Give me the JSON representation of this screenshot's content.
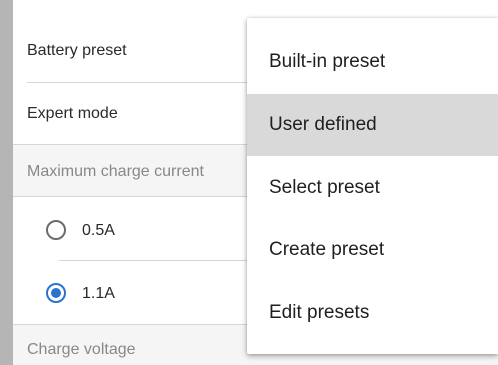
{
  "settings": {
    "battery_preset_label": "Battery preset",
    "expert_mode_label": "Expert mode",
    "max_charge_section": "Maximum charge current",
    "options": [
      {
        "label": "0.5A",
        "checked": false
      },
      {
        "label": "1.1A",
        "checked": true
      }
    ],
    "charge_voltage_section": "Charge voltage"
  },
  "menu": {
    "items": [
      {
        "label": "Built-in preset",
        "highlighted": false
      },
      {
        "label": "User defined",
        "highlighted": true
      },
      {
        "label": "Select preset",
        "highlighted": false
      },
      {
        "label": "Create preset",
        "highlighted": false
      },
      {
        "label": "Edit presets",
        "highlighted": false
      }
    ]
  },
  "colors": {
    "accent_radio": "#2874cf",
    "menu_highlight": "#d9d9d9",
    "section_background": "#f5f5f5"
  }
}
